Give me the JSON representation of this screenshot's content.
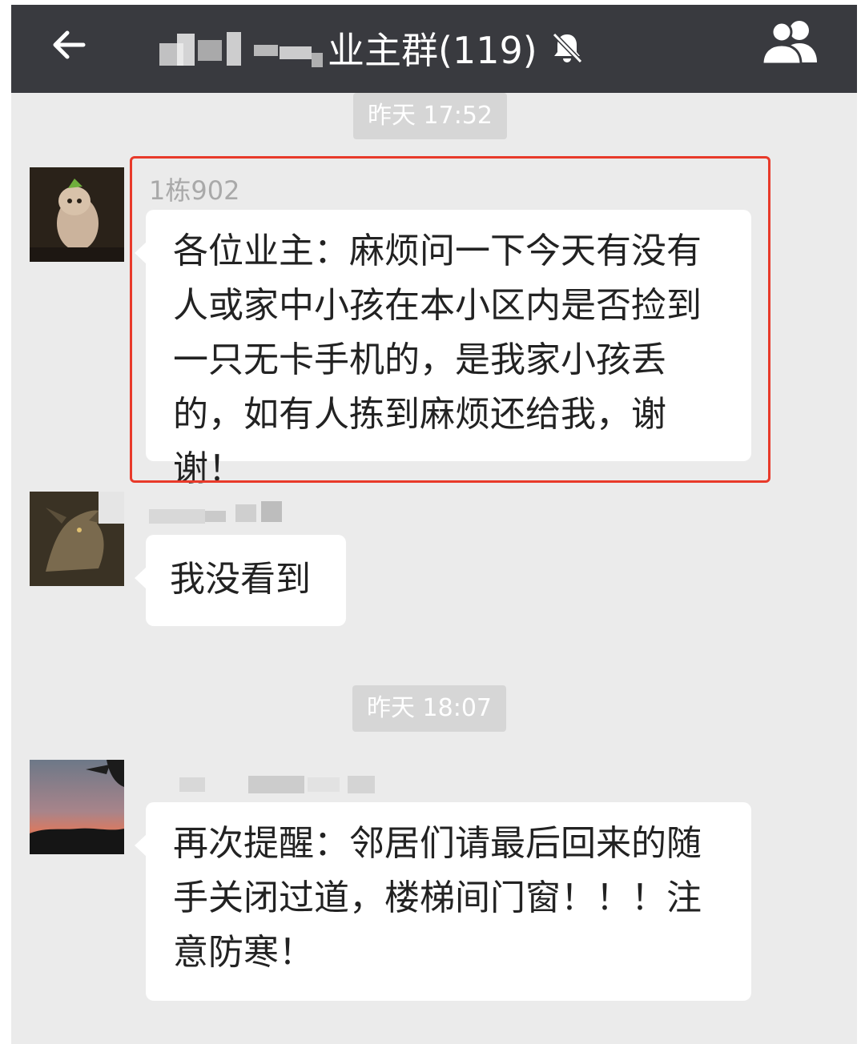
{
  "header": {
    "back_icon": "arrow-left-icon",
    "title": "业主群(119)",
    "mute_icon": "bell-muted-icon",
    "members_icon": "group-members-icon",
    "bar_color": "#393a3f"
  },
  "chat": {
    "background_color": "#ebebeb",
    "timestamps": [
      "昨天 17:52",
      "昨天 18:07"
    ],
    "messages": [
      {
        "sender": "1栋902",
        "text": "各位业主：麻烦问一下今天有没有人或家中小孩在本小区内是否捡到一只无卡手机的，是我家小孩丢的，如有人拣到麻烦还给我，谢谢！",
        "highlighted": true,
        "highlight_color": "#e83a2a"
      },
      {
        "sender": "",
        "text": "我没看到",
        "highlighted": false
      },
      {
        "sender": "",
        "text": "再次提醒：邻居们请最后回来的随手关闭过道，楼梯间门窗！！！注意防寒！",
        "highlighted": false
      }
    ]
  }
}
